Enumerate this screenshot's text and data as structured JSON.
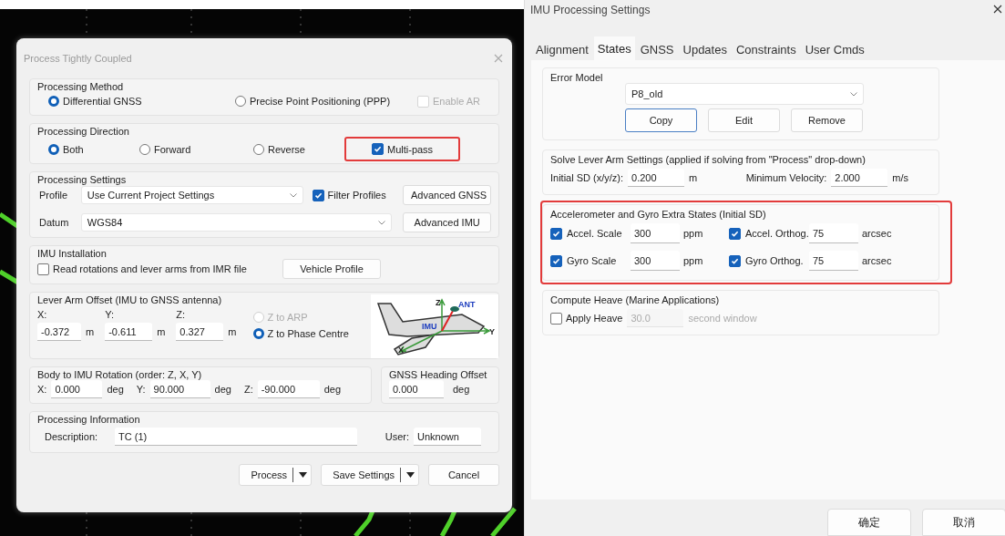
{
  "process_dialog": {
    "title": "Process Tightly Coupled",
    "processing_method": {
      "title": "Processing Method",
      "options": [
        {
          "kind": "radio",
          "label": "Differential GNSS",
          "selected": true,
          "disabled": false
        },
        {
          "kind": "radio",
          "label": "Precise Point Positioning (PPP)",
          "selected": false,
          "disabled": false
        },
        {
          "kind": "checkbox",
          "label": "Enable AR",
          "checked": false,
          "disabled": true
        }
      ]
    },
    "processing_direction": {
      "title": "Processing Direction",
      "options": [
        {
          "kind": "radio",
          "label": "Both",
          "selected": true,
          "highlighted": false
        },
        {
          "kind": "radio",
          "label": "Forward",
          "selected": false,
          "highlighted": false
        },
        {
          "kind": "radio",
          "label": "Reverse",
          "selected": false,
          "highlighted": false
        },
        {
          "kind": "checkbox",
          "label": "Multi-pass",
          "checked": true,
          "highlighted": true
        }
      ]
    },
    "processing_settings": {
      "title": "Processing Settings",
      "profile_label": "Profile",
      "profile_value": "Use Current Project Settings",
      "filter_profiles": {
        "label": "Filter Profiles",
        "checked": true
      },
      "advanced_gnss": "Advanced GNSS",
      "datum_label": "Datum",
      "datum_value": "WGS84",
      "advanced_imu": "Advanced IMU"
    },
    "imu_installation": {
      "title": "IMU Installation",
      "read_from_imr": {
        "label": "Read rotations and lever arms from IMR file",
        "checked": false
      },
      "vehicle_profile": "Vehicle Profile"
    },
    "lever_arm": {
      "title": "Lever Arm Offset (IMU to GNSS antenna)",
      "fields": [
        {
          "label": "X:",
          "value": "-0.372",
          "unit": "m"
        },
        {
          "label": "Y:",
          "value": "-0.611",
          "unit": "m"
        },
        {
          "label": "Z:",
          "value": "0.327",
          "unit": "m"
        }
      ],
      "reference": [
        {
          "label": "Z to ARP",
          "selected": false,
          "disabled": true
        },
        {
          "label": "Z to Phase Centre",
          "selected": true,
          "disabled": false
        }
      ],
      "diagram_labels": [
        "Z",
        "ANT",
        "IMU",
        "Y",
        "X"
      ]
    },
    "rotation": {
      "title": "Body to IMU Rotation (order: Z, X, Y)",
      "fields": [
        {
          "label": "X:",
          "value": "0.000",
          "unit": "deg"
        },
        {
          "label": "Y:",
          "value": "90.000",
          "unit": "deg"
        },
        {
          "label": "Z:",
          "value": "-90.000",
          "unit": "deg"
        }
      ]
    },
    "heading_offset": {
      "title": "GNSS Heading Offset",
      "value": "0.000",
      "unit": "deg"
    },
    "processing_information": {
      "title": "Processing Information",
      "description_label": "Description:",
      "description": "TC (1)",
      "user_label": "User:",
      "user": "Unknown"
    },
    "buttons": [
      {
        "label": "Process",
        "kind": "split"
      },
      {
        "label": "Save Settings",
        "kind": "split"
      },
      {
        "label": "Cancel",
        "kind": "plain"
      }
    ]
  },
  "imu_settings": {
    "title": "IMU Processing Settings",
    "tabs": [
      {
        "label": "Alignment",
        "selected": false
      },
      {
        "label": "States",
        "selected": true
      },
      {
        "label": "GNSS",
        "selected": false
      },
      {
        "label": "Updates",
        "selected": false
      },
      {
        "label": "Constraints",
        "selected": false
      },
      {
        "label": "User Cmds",
        "selected": false
      }
    ],
    "error_model": {
      "title": "Error Model",
      "value": "P8_old",
      "buttons": [
        {
          "label": "Copy",
          "focused": true
        },
        {
          "label": "Edit",
          "focused": false
        },
        {
          "label": "Remove",
          "focused": false
        }
      ]
    },
    "solve_lever_arm": {
      "title": "Solve Lever Arm Settings (applied if solving from \"Process\" drop-down)",
      "fields": [
        {
          "label": "Initial SD (x/y/z):",
          "value": "0.200",
          "unit": "m"
        },
        {
          "label": "Minimum Velocity:",
          "value": "2.000",
          "unit": "m/s"
        }
      ]
    },
    "extra_states": {
      "title": "Accelerometer and Gyro Extra States (Initial SD)",
      "highlighted": true,
      "states": [
        {
          "label": "Accel. Scale",
          "checked": true,
          "value": "300",
          "unit": "ppm"
        },
        {
          "label": "Accel. Orthog.",
          "checked": true,
          "value": "75",
          "unit": "arcsec"
        },
        {
          "label": "Gyro Scale",
          "checked": true,
          "value": "300",
          "unit": "ppm"
        },
        {
          "label": "Gyro Orthog.",
          "checked": true,
          "value": "75",
          "unit": "arcsec"
        }
      ]
    },
    "heave": {
      "title": "Compute Heave (Marine Applications)",
      "label": "Apply Heave",
      "checked": false,
      "value": "30.0",
      "unit": "second window",
      "disabled": true
    },
    "buttons": [
      "确定",
      "取消"
    ]
  }
}
